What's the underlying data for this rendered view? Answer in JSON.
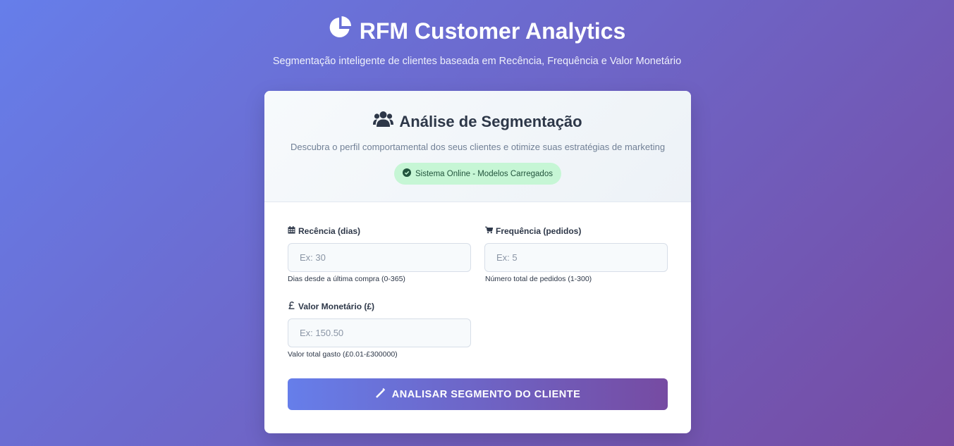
{
  "app": {
    "title": "RFM Customer Analytics",
    "subtitle": "Segmentação inteligente de clientes baseada em Recência, Frequência e Valor Monetário"
  },
  "card": {
    "title": "Análise de Segmentação",
    "description": "Descubra o perfil comportamental dos seus clientes e otimize suas estratégias de marketing",
    "status": "Sistema Online - Modelos Carregados"
  },
  "form": {
    "recency": {
      "label": "Recência (dias)",
      "placeholder": "Ex: 30",
      "value": "",
      "help": "Dias desde a última compra (0-365)",
      "icon": "calendar-icon"
    },
    "frequency": {
      "label": "Frequência (pedidos)",
      "placeholder": "Ex: 5",
      "value": "",
      "help": "Número total de pedidos (1-300)",
      "icon": "cart-icon"
    },
    "monetary": {
      "label": "Valor Monetário (£)",
      "placeholder": "Ex: 150.50",
      "value": "",
      "help": "Valor total gasto (£0.01-£300000)",
      "icon": "pound-icon"
    },
    "submit_label": "ANALISAR SEGMENTO DO CLIENTE"
  },
  "colors": {
    "gradient_start": "#667eea",
    "gradient_end": "#764ba2",
    "status_bg": "#c6f6d5",
    "status_text": "#22543d"
  }
}
